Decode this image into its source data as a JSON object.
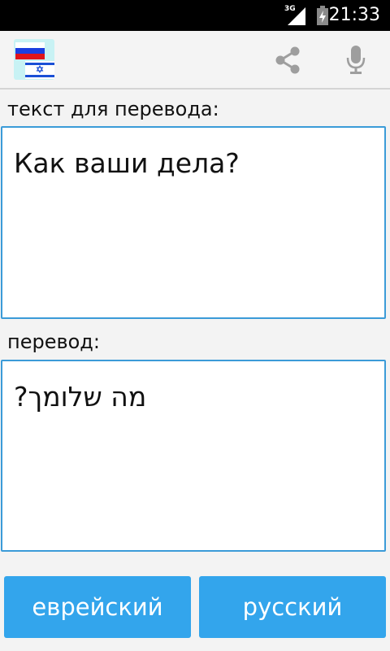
{
  "status_bar": {
    "network": "3G",
    "time": "21:33"
  },
  "action_bar": {
    "logo_icon": "russia-israel-flags-icon",
    "share_icon": "share-icon",
    "mic_icon": "microphone-icon"
  },
  "source": {
    "label": "текст для перевода:",
    "text": "Как ваши дела?"
  },
  "target": {
    "label": "перевод:",
    "text": "מה שלומך?"
  },
  "buttons": {
    "hebrew_label": "еврейский",
    "russian_label": "русский"
  },
  "colors": {
    "accent": "#33a5ec",
    "border": "#3b9bd8"
  }
}
